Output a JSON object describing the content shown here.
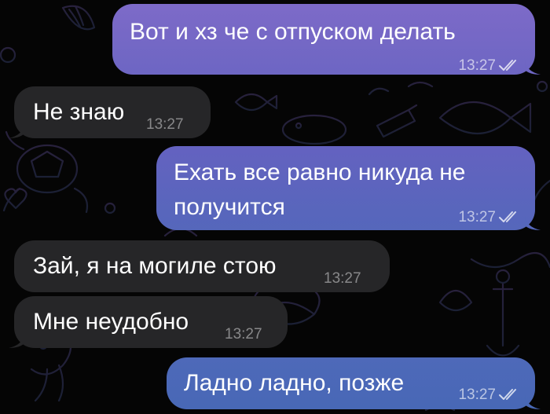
{
  "theme": {
    "background": "#050505",
    "incoming_bubble": "#262628",
    "outgoing_gradient_top": "#7d6cc9",
    "outgoing_gradient_bottom": "#4b68b8"
  },
  "messages": [
    {
      "direction": "out",
      "text": "Вот и хз че с отпуском делать",
      "time": "13:27",
      "status_icon": "double-check-icon"
    },
    {
      "direction": "in",
      "text": "Не знаю",
      "time": "13:27"
    },
    {
      "direction": "out",
      "text_line1": "Ехать все равно никуда не",
      "text_line2": "получится",
      "time": "13:27",
      "status_icon": "double-check-icon"
    },
    {
      "direction": "in",
      "text": "Зай, я на могиле стою",
      "time": "13:27"
    },
    {
      "direction": "in",
      "text": "Мне неудобно",
      "time": "13:27"
    },
    {
      "direction": "out",
      "text": "Ладно ладно, позже",
      "time": "13:27",
      "status_icon": "double-check-icon"
    }
  ]
}
